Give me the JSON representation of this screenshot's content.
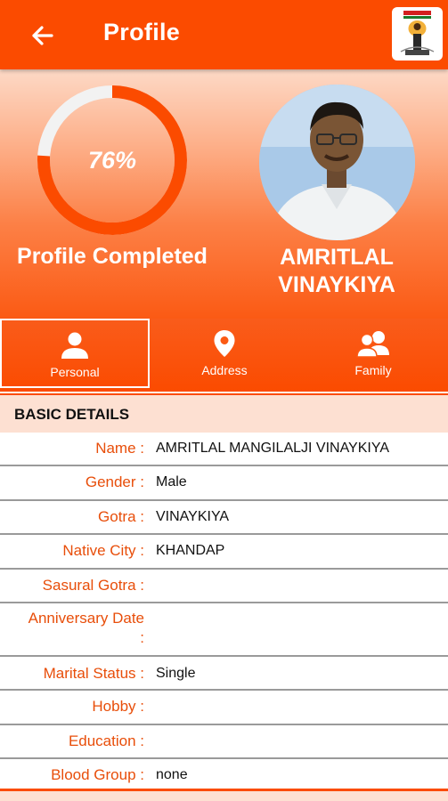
{
  "app_bar": {
    "title": "Profile",
    "back_icon": "arrow-left-icon",
    "logo_icon": "community-logo-icon"
  },
  "profile_summary": {
    "completion_label": "76%",
    "completion_fraction": 0.76,
    "completed_caption": "Profile Completed",
    "name_line1": "AMRITLAL",
    "name_line2": "VINAYKIYA"
  },
  "tabs": [
    {
      "label": "Personal",
      "icon": "person-icon",
      "active": true
    },
    {
      "label": "Address",
      "icon": "location-pin-icon",
      "active": false
    },
    {
      "label": "Family",
      "icon": "family-icon",
      "active": false
    }
  ],
  "section": {
    "title": "BASIC DETAILS"
  },
  "details": [
    {
      "label": "Name :",
      "value": "AMRITLAL MANGILALJI VINAYKIYA"
    },
    {
      "label": "Gender :",
      "value": "Male"
    },
    {
      "label": "Gotra :",
      "value": "VINAYKIYA"
    },
    {
      "label": "Native City :",
      "value": "KHANDAP"
    },
    {
      "label": "Sasural Gotra :",
      "value": ""
    },
    {
      "label_line1": "Anniversary Date",
      "label_line2": ":",
      "value": ""
    },
    {
      "label": "Marital Status :",
      "value": "Single"
    },
    {
      "label": "Hobby :",
      "value": ""
    },
    {
      "label": "Education :",
      "value": ""
    },
    {
      "label": "Blood Group :",
      "value": "none"
    }
  ],
  "colors": {
    "primary": "#fb4b00",
    "label_text": "#e84e0a",
    "section_bg": "#fde0d2"
  }
}
